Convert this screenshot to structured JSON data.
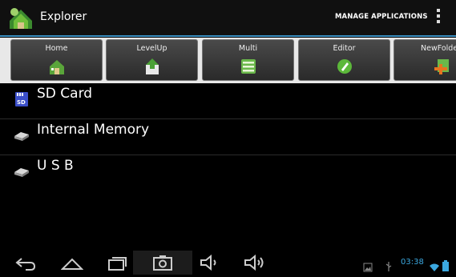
{
  "app": {
    "title": "Explorer",
    "manage_label": "MANAGE APPLICATIONS"
  },
  "toolbar": {
    "buttons": [
      {
        "label": "Home",
        "icon": "home-icon"
      },
      {
        "label": "LevelUp",
        "icon": "level-up-icon"
      },
      {
        "label": "Multi",
        "icon": "multi-select-icon"
      },
      {
        "label": "Editor",
        "icon": "editor-icon"
      },
      {
        "label": "NewFolde",
        "icon": "new-folder-icon"
      }
    ]
  },
  "storage": [
    {
      "label": "SD Card",
      "icon": "sd-card-icon"
    },
    {
      "label": "Internal Memory",
      "icon": "drive-icon"
    },
    {
      "label": "U S B",
      "icon": "drive-icon"
    }
  ],
  "status": {
    "time": "03:38"
  },
  "colors": {
    "accent": "#3a8fc2",
    "time": "#3ba8e0"
  }
}
